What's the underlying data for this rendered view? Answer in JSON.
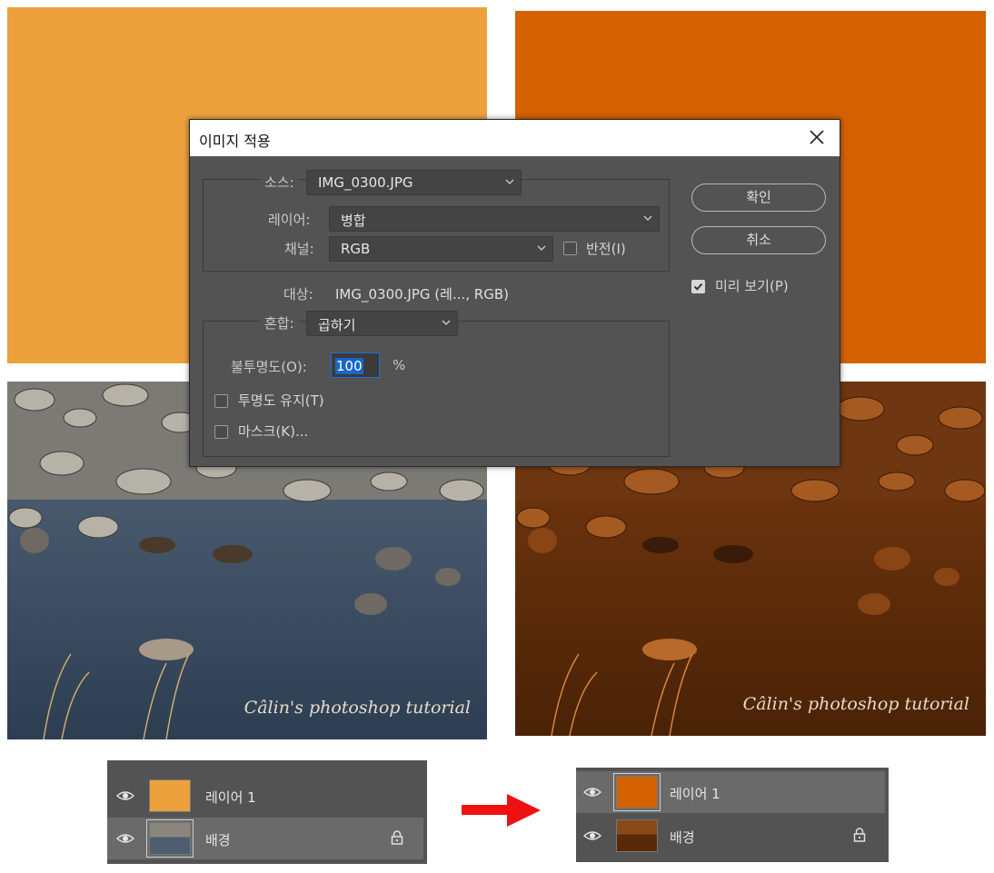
{
  "colors": {
    "swatch_light_orange": "#eca13d",
    "swatch_dark_orange": "#d46100",
    "dialog_bg": "#535353",
    "arrow_red": "#ee1111"
  },
  "watermark_left": "Câlin's photoshop tutorial",
  "watermark_right": "Câlin's photoshop tutorial",
  "dialog": {
    "title": "이미지 적용",
    "close_icon": "close-icon",
    "source": {
      "label": "소스:",
      "value": "IMG_0300.JPG"
    },
    "layer": {
      "label": "레이어:",
      "value": "병합"
    },
    "channel": {
      "label": "채널:",
      "value": "RGB"
    },
    "invert": {
      "label": "반전(I)",
      "checked": false
    },
    "target": {
      "label": "대상:",
      "value": "IMG_0300.JPG (레..., RGB)"
    },
    "blending": {
      "label": "혼합:",
      "value": "곱하기"
    },
    "opacity": {
      "label": "불투명도(O):",
      "value": "100",
      "unit": "%"
    },
    "preserve_transparency": {
      "label": "투명도 유지(T)",
      "checked": false
    },
    "mask": {
      "label": "마스크(K)...",
      "checked": false
    },
    "ok_label": "확인",
    "cancel_label": "취소",
    "preview": {
      "label": "미리 보기(P)",
      "checked": true
    }
  },
  "layers_before": {
    "rows": [
      {
        "name": "레이어 1",
        "thumb": "orange-fill",
        "locked": false,
        "selected": false
      },
      {
        "name": "배경",
        "thumb": "photo",
        "locked": true,
        "selected": true
      }
    ]
  },
  "layers_after": {
    "rows": [
      {
        "name": "레이어 1",
        "thumb": "dark-orange-fill",
        "locked": false,
        "selected": true
      },
      {
        "name": "배경",
        "thumb": "tinted-photo",
        "locked": true,
        "selected": false
      }
    ]
  }
}
